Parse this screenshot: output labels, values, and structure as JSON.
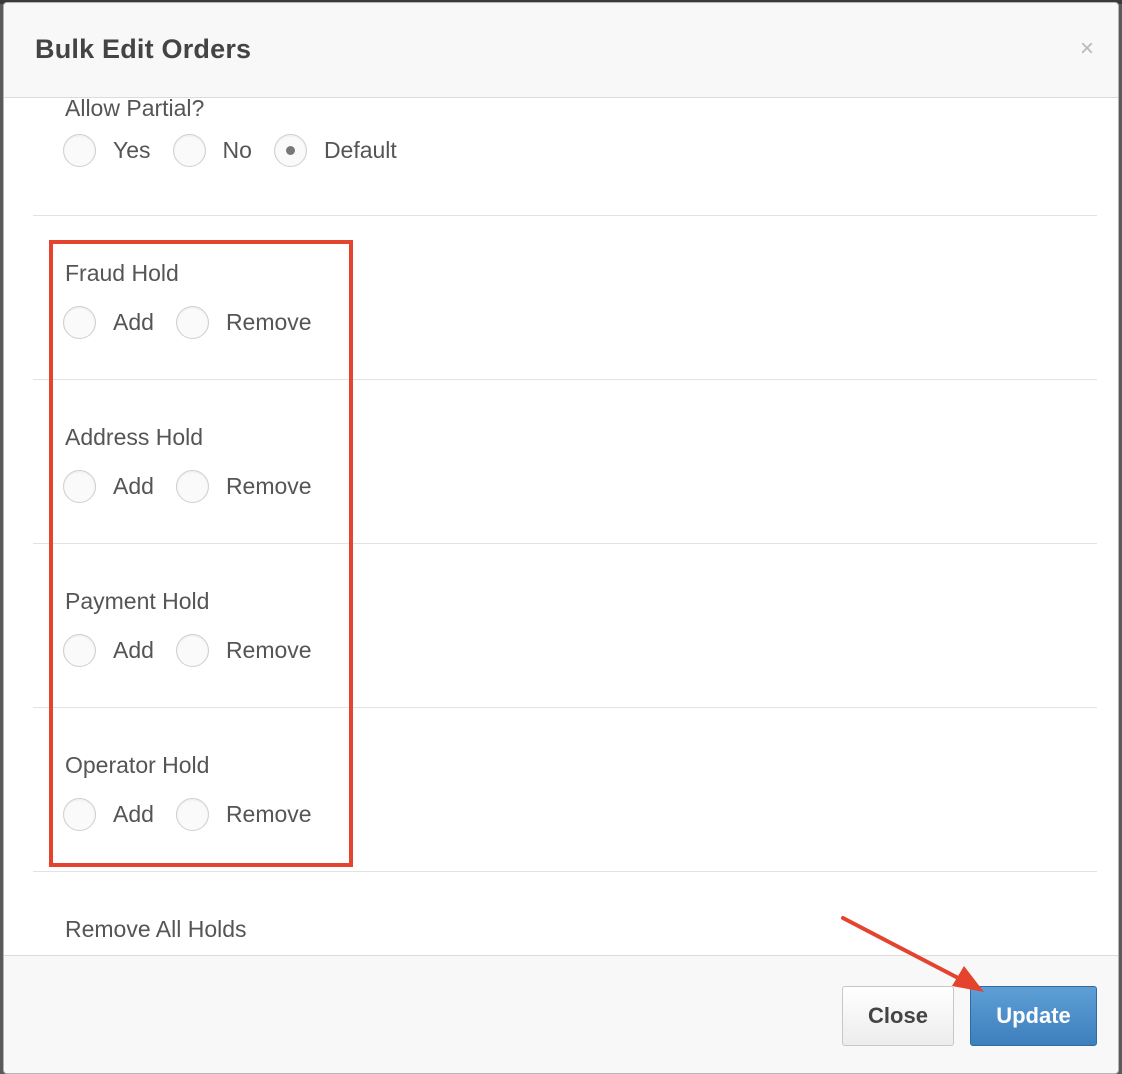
{
  "modal": {
    "title": "Bulk Edit Orders",
    "close_glyph": "×"
  },
  "allow_partial": {
    "label": "Allow Partial?",
    "options": [
      "Yes",
      "No",
      "Default"
    ],
    "selected": "Default"
  },
  "holds": [
    {
      "label": "Fraud Hold",
      "add": "Add",
      "remove": "Remove"
    },
    {
      "label": "Address Hold",
      "add": "Add",
      "remove": "Remove"
    },
    {
      "label": "Payment Hold",
      "add": "Add",
      "remove": "Remove"
    },
    {
      "label": "Operator Hold",
      "add": "Add",
      "remove": "Remove"
    }
  ],
  "remove_all_holds": {
    "label": "Remove All Holds"
  },
  "footer": {
    "close_label": "Close",
    "update_label": "Update"
  },
  "annotations": {
    "highlight_color": "#e4432e",
    "arrow_color": "#e4432e"
  },
  "colors": {
    "primary": "#4a8cc9",
    "text": "#555555"
  }
}
